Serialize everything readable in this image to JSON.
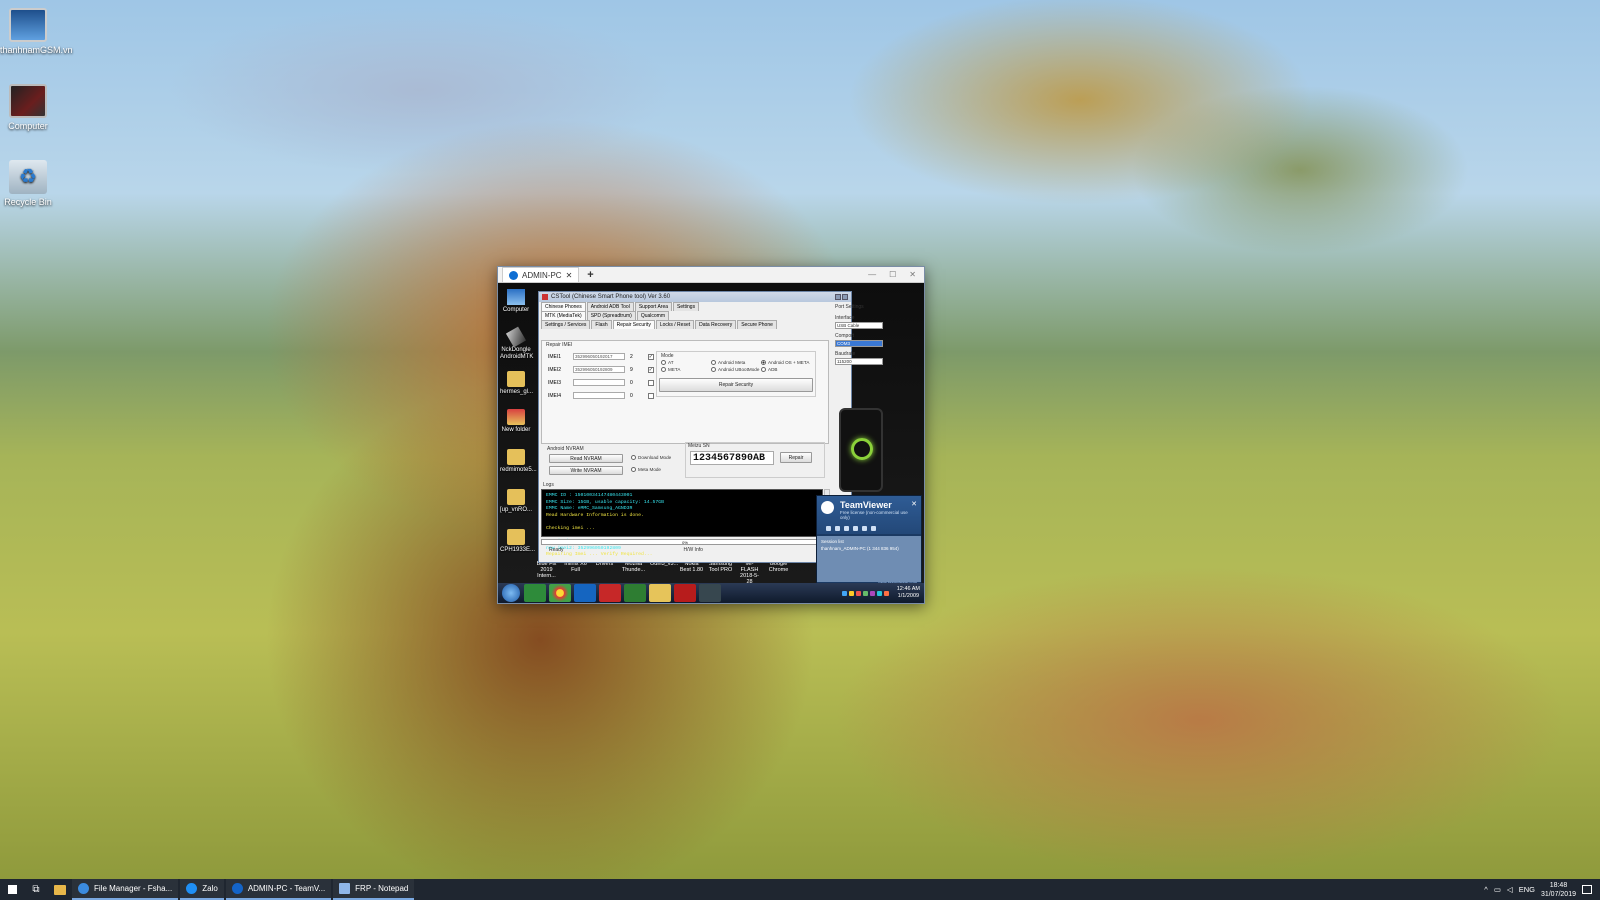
{
  "desktop": {
    "icons": [
      {
        "label": "thanhnamGSM.vn"
      },
      {
        "label": "Computer"
      },
      {
        "label": "Recycle Bin"
      }
    ]
  },
  "tv_window": {
    "tab_title": "ADMIN-PC",
    "remote_desktop": {
      "icons": [
        {
          "label": "Computer"
        },
        {
          "label": "NckDongle AndroidMTK"
        },
        {
          "label": "hermes_gl..."
        },
        {
          "label": "New folder"
        },
        {
          "label": "redmimote5..."
        },
        {
          "label": "[up_vnRO..."
        },
        {
          "label": "CPH1933E..."
        }
      ],
      "bottom_labels": [
        "Blue Fix 2019 Intern...",
        "Infinix X6 Full",
        "Drivers",
        "Mozilla Thunde...",
        "Odin3_v3...",
        "Nokia Best 1.80",
        "Samsung Tool PRO",
        "MI-FLASH 2018-5-28",
        "Google Chrome"
      ]
    },
    "cstool": {
      "title": "CSTool (Chinese Smart Phone tool) Ver 3.60",
      "tabs_level1": [
        "Chinese Phones",
        "Android ADB Tool",
        "Support Area",
        "Settings"
      ],
      "tabs_level2": [
        "MTK (MediaTek)",
        "SPD (Spreadtrum)",
        "Qualcomm"
      ],
      "tabs_level3": [
        "Settings / Services",
        "Flash",
        "Repair Security",
        "Locks / Reset",
        "Data Recovery",
        "Secure Phone"
      ],
      "repair_imei": {
        "label": "Repair IMEI",
        "rows": [
          {
            "label": "IMEI1",
            "value": "352996050192017",
            "digit": "2",
            "checked": true
          },
          {
            "label": "IMEI2",
            "value": "352996050192809",
            "digit": "9",
            "checked": true
          },
          {
            "label": "IMEI3",
            "value": "",
            "digit": "0",
            "checked": false
          },
          {
            "label": "IMEI4",
            "value": "",
            "digit": "0",
            "checked": false
          }
        ]
      },
      "mode": {
        "label": "Mode",
        "options": [
          {
            "label": "AT",
            "selected": false
          },
          {
            "label": "META",
            "selected": false
          },
          {
            "label": "Android Meta",
            "selected": false
          },
          {
            "label": "Android UBootMode",
            "selected": false
          },
          {
            "label": "Android OS + META",
            "selected": true
          },
          {
            "label": "ADB",
            "selected": false
          }
        ],
        "repair_button": "Repair Security"
      },
      "android_nvram": {
        "label": "Android NVRAM",
        "read_button": "Read NVRAM",
        "write_button": "Write NVRAM",
        "download_mode": "Download Mode",
        "meta_mode": "Meta Mode"
      },
      "meizu": {
        "label": "Meizu SN",
        "value": "1234567890AB",
        "repair_button": "Repair"
      },
      "log": {
        "label": "Logs",
        "lines": [
          {
            "text": "EMMC ID : 15010034147480443001",
            "style": "c"
          },
          {
            "text": "EMMC Size: 15GB, usable capacity: 14.57GB",
            "style": "c"
          },
          {
            "text": "EMMC Name: eMMC_Samsung_AGND3R",
            "style": "c"
          },
          {
            "text": "Read Hardware Information is done.",
            "style": "y"
          },
          {
            "text": "",
            "style": "c"
          },
          {
            "text": "Checking imei ...",
            "style": "y"
          },
          {
            "text": "",
            "style": "c"
          },
          {
            "text": "new imei1: 352996050192017",
            "style": "c"
          },
          {
            "text": "new imei2: 352996050192809",
            "style": "c"
          },
          {
            "text": "Repairing Imei ... Verify Required...",
            "style": "y"
          }
        ]
      },
      "progress": "0%",
      "status": {
        "left": "Ready",
        "right": "H/W Info"
      },
      "port_settings": {
        "label": "Port Settings",
        "interface_label": "Interface",
        "interface_value": "USB Cable",
        "comport_label": "Comport",
        "comport_value": "COM3",
        "baudrate_label": "Baudrate",
        "baudrate_value": "115200"
      }
    },
    "tv_popup": {
      "brand": "TeamViewer",
      "subtitle": "Free license (non-commercial use only)",
      "session_label": "Session list",
      "session_item": "thanhnam_ADMIN-PC (1 344 836 954)",
      "link": "www.teamviewer.com"
    },
    "remote_clock": {
      "time": "12:46 AM",
      "date": "1/1/2009"
    }
  },
  "taskbar": {
    "buttons": [
      {
        "label": "File Manager - Fsha...",
        "color": "#3b8be0"
      },
      {
        "label": "Zalo",
        "color": "#1f8ff5"
      },
      {
        "label": "ADMIN-PC - TeamV...",
        "color": "#1464c8"
      },
      {
        "label": "FRP - Notepad",
        "color": "#8fb6e8"
      }
    ],
    "lang": "ENG",
    "time": "18:48",
    "date": "31/07/2019"
  }
}
